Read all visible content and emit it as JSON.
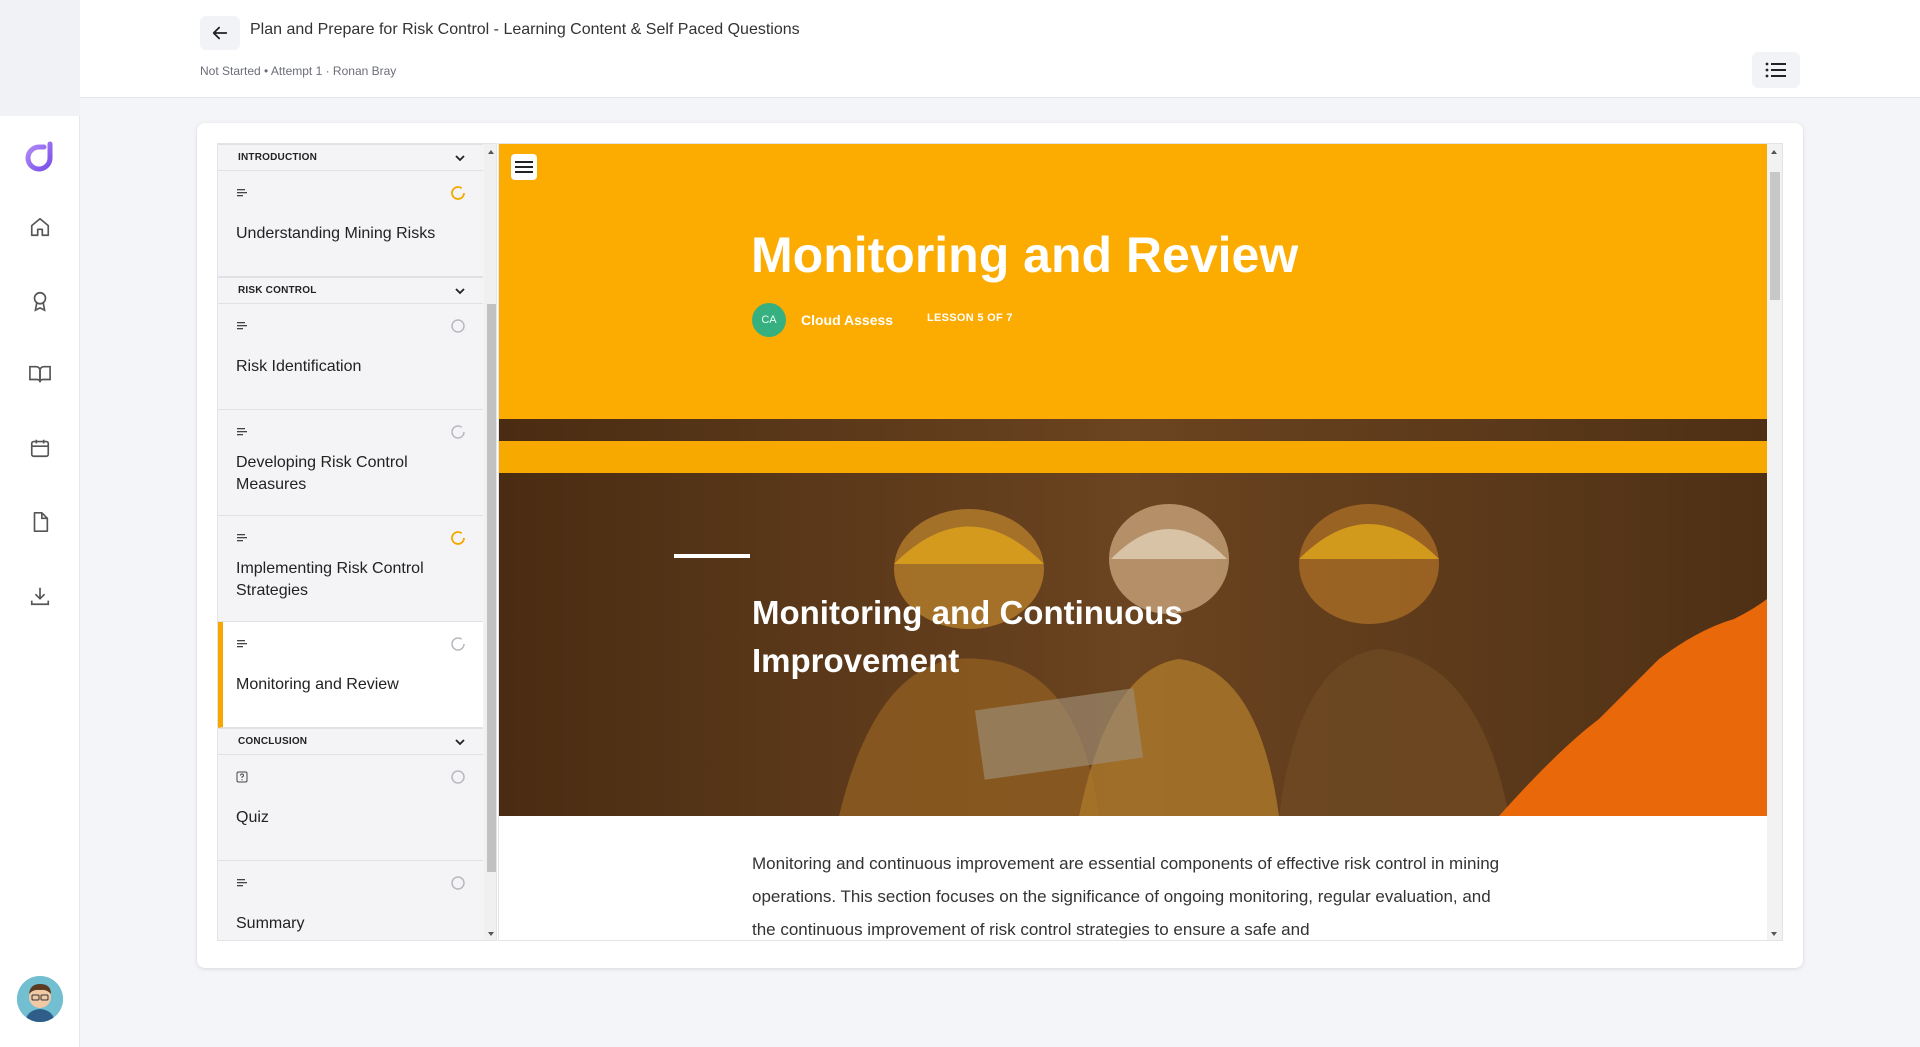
{
  "header": {
    "title": "Plan and Prepare for Risk Control - Learning Content & Self Paced Questions",
    "meta": "Not Started • Attempt 1 · Ronan Bray"
  },
  "rail": {
    "icons": [
      "home-icon",
      "award-icon",
      "book-icon",
      "calendar-icon",
      "document-icon",
      "download-icon"
    ]
  },
  "sidebar": {
    "sections": [
      {
        "label": "INTRODUCTION",
        "lessons": [
          {
            "name": "Understanding Mining Risks",
            "type": "text",
            "status": "in-progress"
          }
        ]
      },
      {
        "label": "RISK CONTROL",
        "lessons": [
          {
            "name": "Risk Identification",
            "type": "text",
            "status": "not-started"
          },
          {
            "name": "Developing Risk Control Measures",
            "type": "text",
            "status": "not-started"
          },
          {
            "name": "Implementing Risk Control Strategies",
            "type": "text",
            "status": "in-progress"
          },
          {
            "name": "Monitoring and Review",
            "type": "text",
            "status": "not-started",
            "active": true
          }
        ]
      },
      {
        "label": "CONCLUSION",
        "lessons": [
          {
            "name": "Quiz",
            "type": "quiz",
            "status": "not-started"
          },
          {
            "name": "Summary",
            "type": "text",
            "status": "not-started"
          }
        ]
      }
    ]
  },
  "lesson": {
    "title": "Monitoring and Review",
    "author_initials": "CA",
    "author": "Cloud Assess",
    "count": "LESSON 5 OF 7",
    "heading": "Monitoring and Continuous Improvement",
    "body": "Monitoring and continuous improvement are essential components of effective risk control in mining operations. This section focuses on the significance of ongoing monitoring, regular evaluation, and the continuous improvement of risk control strategies to ensure a safe and"
  },
  "colors": {
    "accent": "#fcac00",
    "active_border": "#f7a800",
    "brand": "#8b5cf6",
    "author_badge": "#36b07f"
  }
}
